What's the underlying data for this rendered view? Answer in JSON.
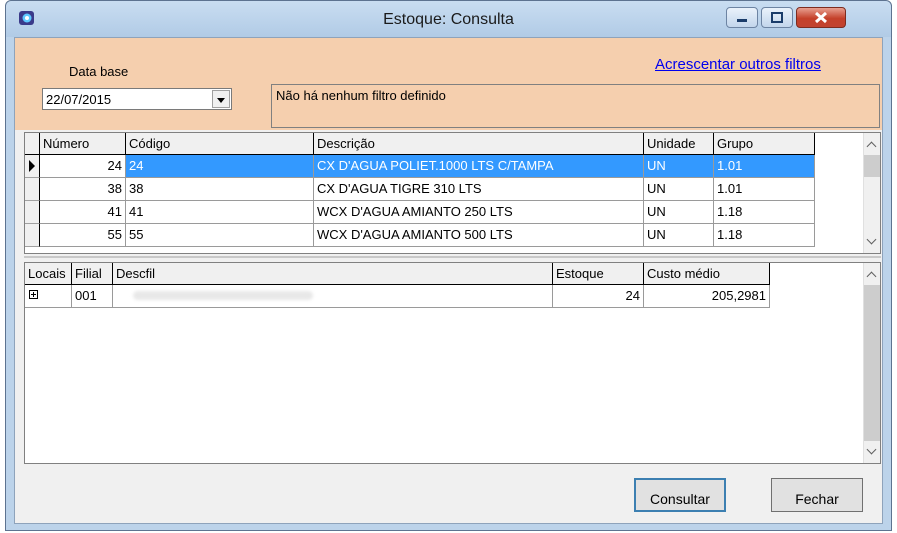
{
  "window": {
    "title": "Estoque: Consulta"
  },
  "filters": {
    "date_label": "Data base",
    "date_value": "22/07/2015",
    "add_filters_link": "Acrescentar outros filtros",
    "filter_status": "Não há nenhum filtro definido"
  },
  "products_grid": {
    "columns": [
      "Número",
      "Código",
      "Descrição",
      "Unidade",
      "Grupo"
    ],
    "rows": [
      {
        "numero": "24",
        "codigo": "24",
        "descricao": "CX D'AGUA POLIET.1000 LTS C/TAMPA",
        "unidade": "UN",
        "grupo": "1.01",
        "selected": true
      },
      {
        "numero": "38",
        "codigo": "38",
        "descricao": "CX D'AGUA TIGRE 310 LTS",
        "unidade": "UN",
        "grupo": "1.01",
        "selected": false
      },
      {
        "numero": "41",
        "codigo": "41",
        "descricao": "WCX D'AGUA AMIANTO 250 LTS",
        "unidade": "UN",
        "grupo": "1.18",
        "selected": false
      },
      {
        "numero": "55",
        "codigo": "55",
        "descricao": "WCX D'AGUA AMIANTO 500 LTS",
        "unidade": "UN",
        "grupo": "1.18",
        "selected": false
      }
    ]
  },
  "stock_grid": {
    "columns": [
      "Locais",
      "Filial",
      "Descfil",
      "Estoque",
      "Custo médio"
    ],
    "rows": [
      {
        "filial": "001",
        "descfil": "",
        "estoque": "24",
        "custo_medio": "205,2981"
      }
    ]
  },
  "buttons": {
    "consultar": "Consultar",
    "fechar": "Fechar"
  },
  "colors": {
    "filter_panel": "#f5cfae",
    "selection": "#3399ff",
    "link": "#0000ee"
  }
}
